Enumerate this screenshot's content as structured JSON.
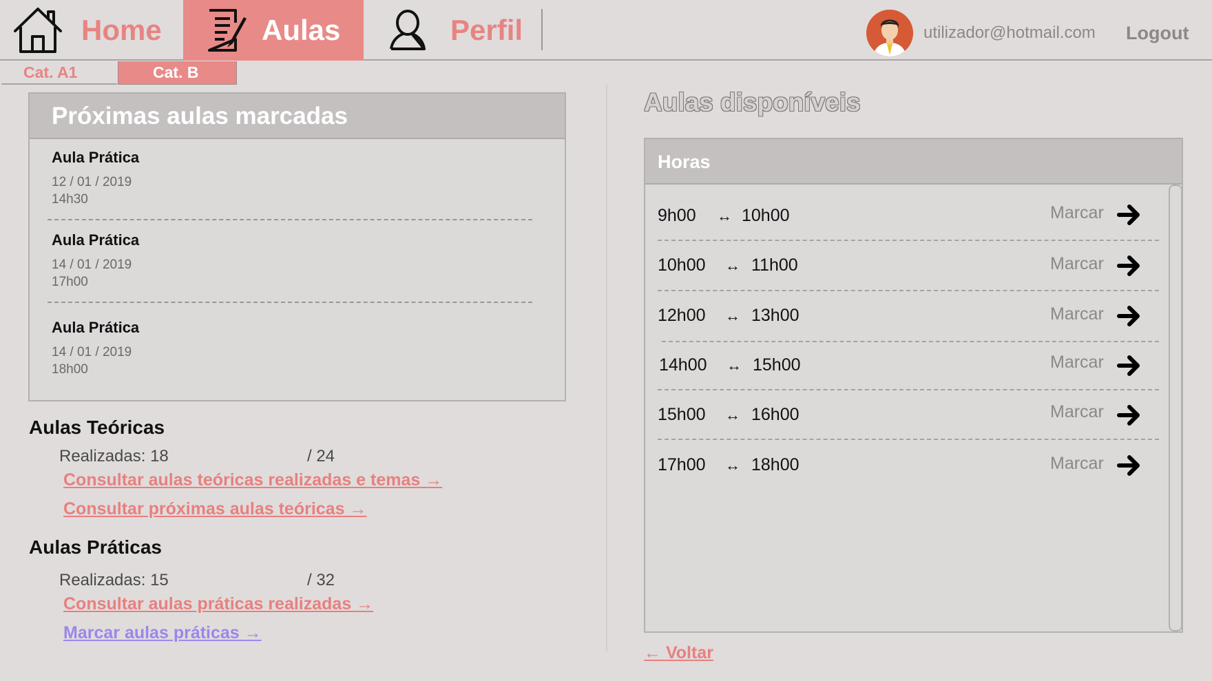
{
  "nav": {
    "items": [
      {
        "label": "Home",
        "icon": "home-icon",
        "active": false
      },
      {
        "label": "Aulas",
        "icon": "document-edit-icon",
        "active": true
      },
      {
        "label": "Perfil",
        "icon": "user-icon",
        "active": false
      }
    ],
    "user_email": "utilizador@hotmail.com",
    "logout_label": "Logout"
  },
  "categories": [
    {
      "label": "Cat. A1",
      "active": false
    },
    {
      "label": "Cat. B",
      "active": true
    }
  ],
  "upcoming": {
    "title": "Próximas aulas marcadas",
    "lessons": [
      {
        "type": "Aula Prática",
        "date": "12 / 01 / 2019",
        "time": "14h30"
      },
      {
        "type": "Aula Prática",
        "date": "14 / 01 / 2019",
        "time": "17h00"
      },
      {
        "type": "Aula Prática",
        "date": "14 / 01 / 2019",
        "time": "18h00"
      }
    ]
  },
  "theory": {
    "title": "Aulas Teóricas",
    "done_label": "Realizadas: 18",
    "total_label": "/ 24",
    "done": 18,
    "total": 24,
    "links": [
      "Consultar aulas teóricas realizadas e temas →",
      "Consultar próximas aulas teóricas →"
    ]
  },
  "practice": {
    "title": "Aulas Práticas",
    "done_label": "Realizadas: 15",
    "total_label": "/ 32",
    "done": 15,
    "total": 32,
    "links": [
      "Consultar aulas práticas realizadas →",
      "Marcar aulas práticas →"
    ]
  },
  "available": {
    "title": "Aulas disponíveis",
    "header": "Horas",
    "arrow_glyph": "↔",
    "book_label": "Marcar",
    "slots": [
      {
        "start": "9h00",
        "end": "10h00"
      },
      {
        "start": "10h00",
        "end": "11h00"
      },
      {
        "start": "12h00",
        "end": "13h00"
      },
      {
        "start": "14h00",
        "end": "15h00"
      },
      {
        "start": "15h00",
        "end": "16h00"
      },
      {
        "start": "17h00",
        "end": "18h00"
      }
    ]
  },
  "back_label": "← Voltar",
  "colors": {
    "accent": "#e88a88",
    "link": "#e8807e",
    "link_visited": "#9c86ea",
    "background": "#e0dcdc",
    "panel_header": "#c4c0c0"
  }
}
